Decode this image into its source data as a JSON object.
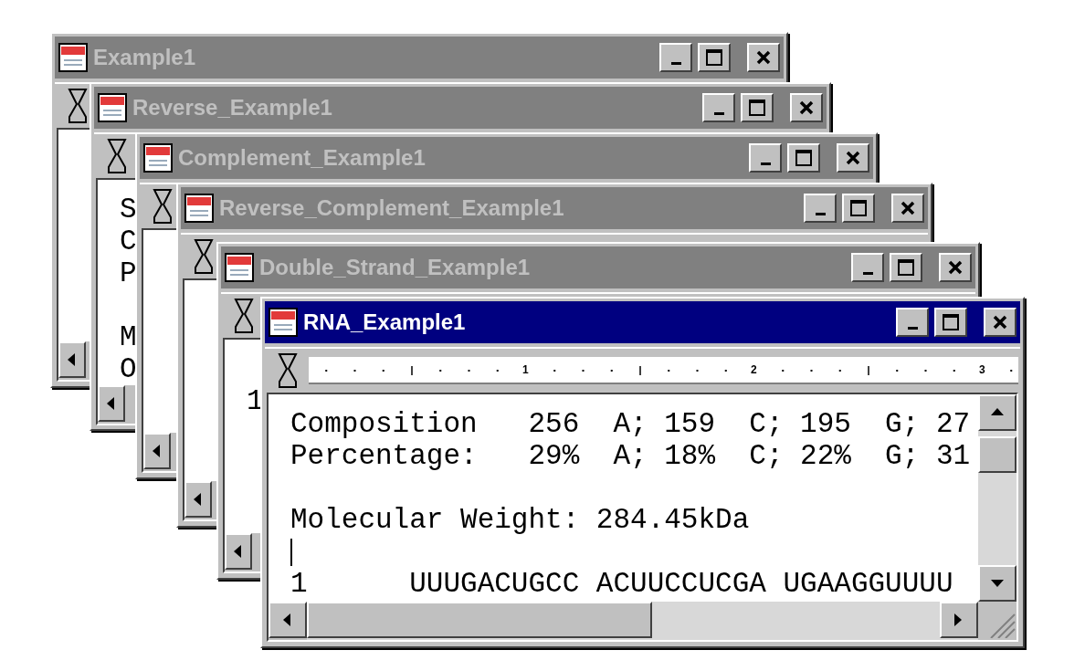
{
  "windows": [
    {
      "title": "Example1",
      "active": false
    },
    {
      "title": "Reverse_Example1",
      "active": false,
      "lines": [
        {
          "kind": "text",
          "text": "S"
        },
        {
          "kind": "text",
          "text": "C"
        },
        {
          "kind": "text",
          "text": "P"
        },
        {
          "kind": "blank"
        },
        {
          "kind": "text",
          "text": "M"
        },
        {
          "kind": "text",
          "text": "O"
        }
      ]
    },
    {
      "title": "Complement_Example1",
      "active": false
    },
    {
      "title": "Reverse_Complement_Example1",
      "active": false
    },
    {
      "title": "Double_Strand_Example1",
      "active": false,
      "lines": [
        {
          "kind": "blank"
        },
        {
          "kind": "text",
          "text": "1"
        }
      ]
    },
    {
      "title": "RNA_Example1",
      "active": true,
      "ruler_labels": [
        "1",
        "2",
        "3"
      ],
      "lines": [
        {
          "kind": "text",
          "text": "Composition   256  A; 159  C; 195  G; 27"
        },
        {
          "kind": "text",
          "text": "Percentage:   29%  A; 18%  C; 22%  G; 31"
        },
        {
          "kind": "blank"
        },
        {
          "kind": "text",
          "text": "Molecular Weight: 284.45kDa"
        },
        {
          "kind": "caret"
        },
        {
          "kind": "text",
          "text": "1      UUUGACUGCC ACUUCCUCGA UGAAGGUUUU"
        }
      ]
    }
  ]
}
